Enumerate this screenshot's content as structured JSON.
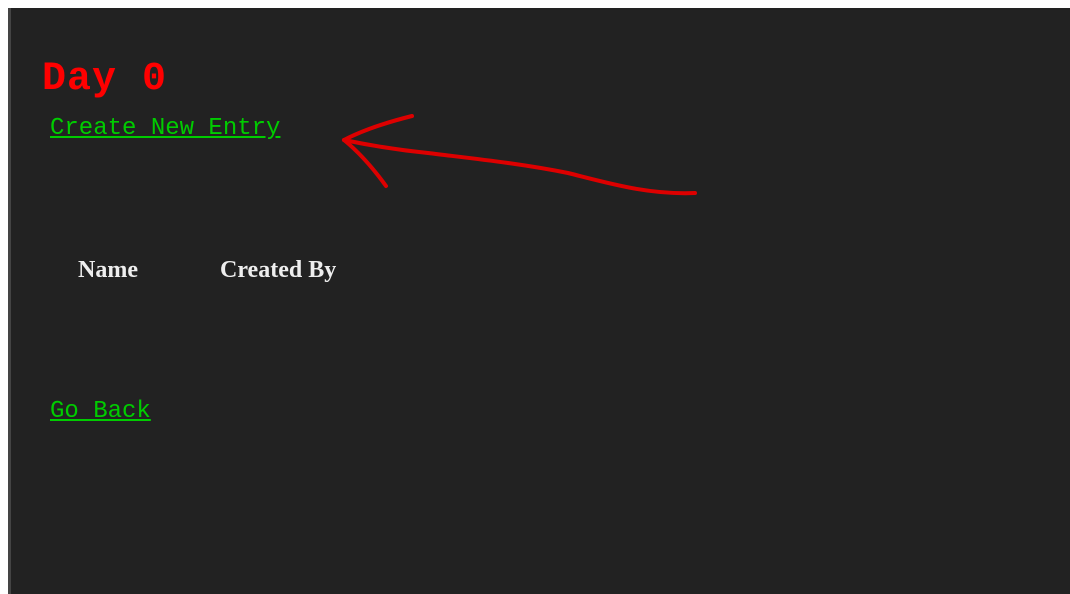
{
  "page": {
    "title": "Day 0",
    "create_link": "Create New Entry",
    "go_back_link": "Go Back"
  },
  "table": {
    "columns": [
      "Name",
      "Created By"
    ],
    "rows": []
  },
  "colors": {
    "background": "#222222",
    "title": "#ff0000",
    "link": "#00cc00",
    "header_text": "#eeeeee",
    "annotation_arrow": "#dd0000"
  },
  "icons": {
    "annotation": "arrow-icon"
  }
}
